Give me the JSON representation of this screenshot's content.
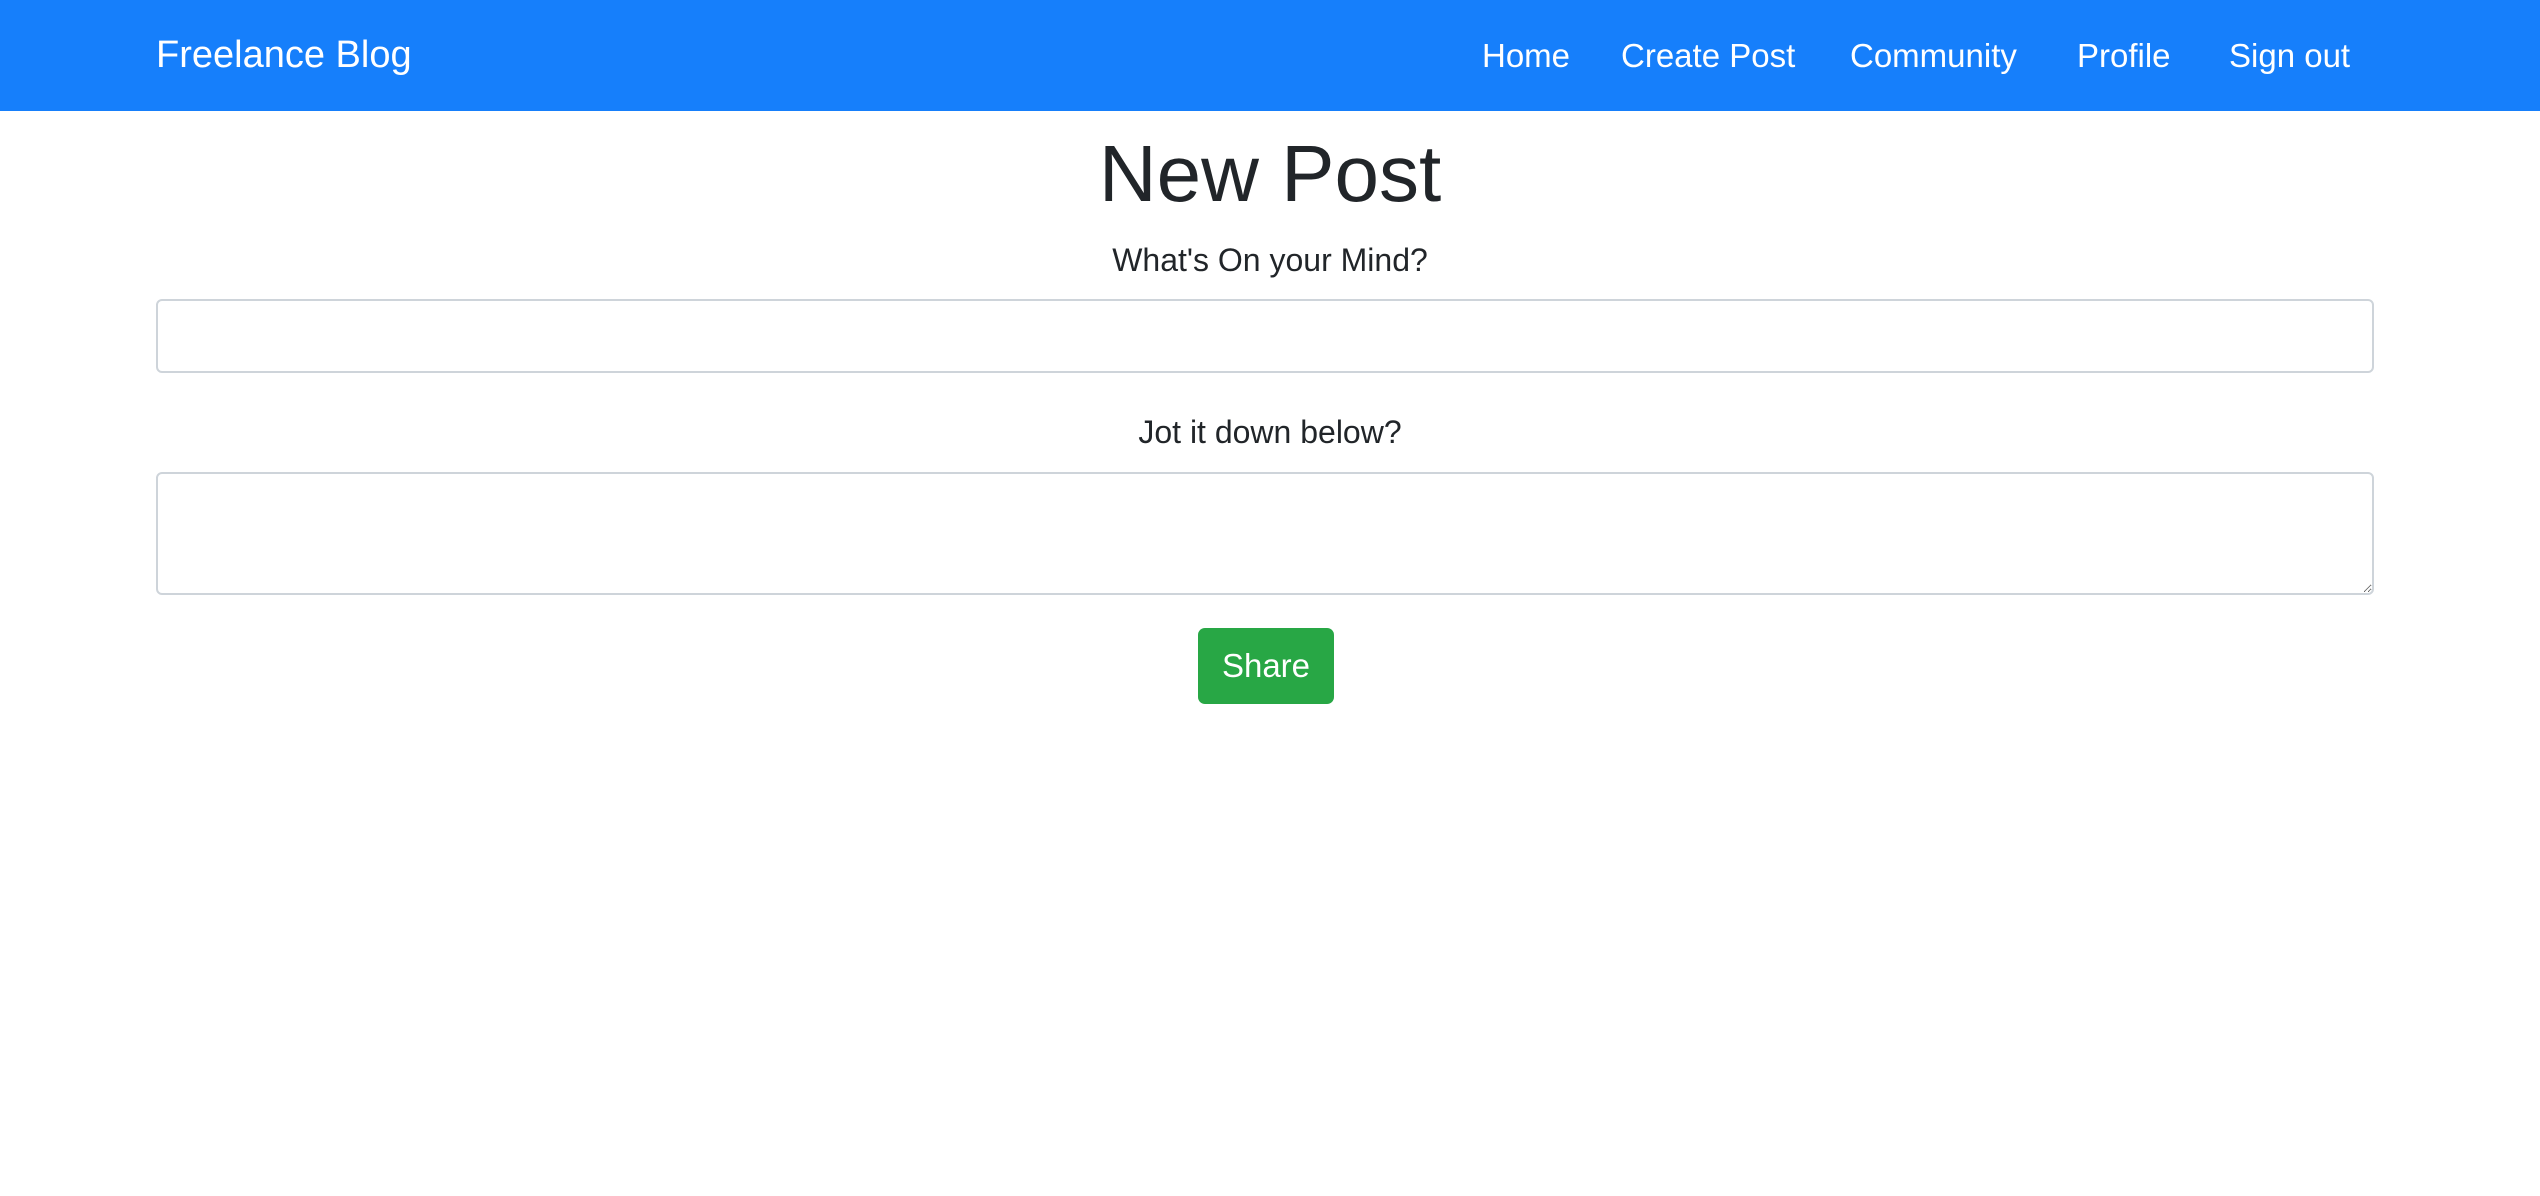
{
  "navbar": {
    "brand": "Freelance Blog",
    "links": [
      {
        "label": "Home"
      },
      {
        "label": "Create Post"
      },
      {
        "label": "Community"
      },
      {
        "label": "Profile"
      },
      {
        "label": "Sign out"
      }
    ],
    "background_color": "#167ffb"
  },
  "main": {
    "title": "New Post",
    "title_field": {
      "label": "What's On your Mind?",
      "value": "",
      "placeholder": ""
    },
    "body_field": {
      "label": "Jot it down below?",
      "value": "",
      "placeholder": ""
    },
    "share_button": {
      "label": "Share",
      "color": "#28a745"
    }
  }
}
